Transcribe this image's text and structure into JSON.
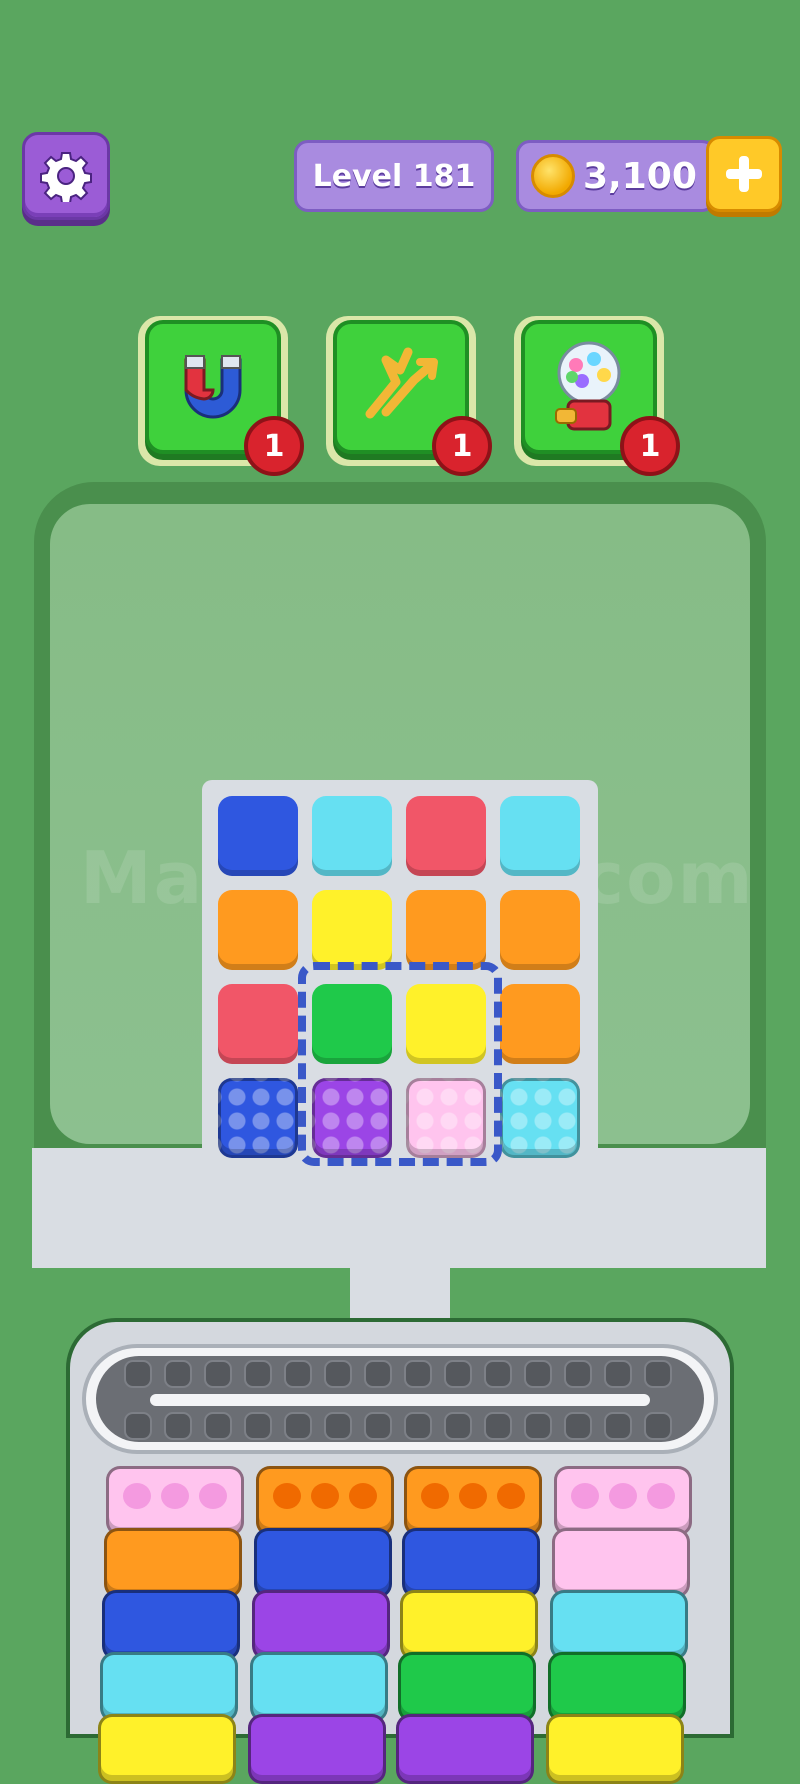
{
  "header": {
    "level_label": "Level 181",
    "coins": "3,100"
  },
  "boosters": [
    {
      "name": "magnet",
      "count": "1"
    },
    {
      "name": "shuffle",
      "count": "1"
    },
    {
      "name": "gumball",
      "count": "1"
    }
  ],
  "watermark": "MarbleSort.com",
  "colors": {
    "blue": "#2f57e0",
    "cyan": "#66e0f2",
    "red": "#f15668",
    "orange": "#ff9a1f",
    "yellow": "#fff12a",
    "green": "#1fc94a",
    "purple": "#9b45e6",
    "pink": "#ffc4ee"
  },
  "grid": [
    [
      "blue",
      "cyan",
      "red",
      "cyan"
    ],
    [
      "orange",
      "yellow",
      "orange",
      "orange"
    ],
    [
      "red",
      "green",
      "yellow",
      "orange"
    ],
    [
      "blue",
      "purple",
      "pink",
      "cyan"
    ]
  ],
  "columns": [
    [
      "pink",
      "orange",
      "blue",
      "cyan",
      "yellow"
    ],
    [
      "orange",
      "blue",
      "purple",
      "cyan",
      "purple"
    ],
    [
      "orange",
      "blue",
      "yellow",
      "green",
      "purple"
    ],
    [
      "pink",
      "pink",
      "cyan",
      "green",
      "yellow"
    ]
  ]
}
